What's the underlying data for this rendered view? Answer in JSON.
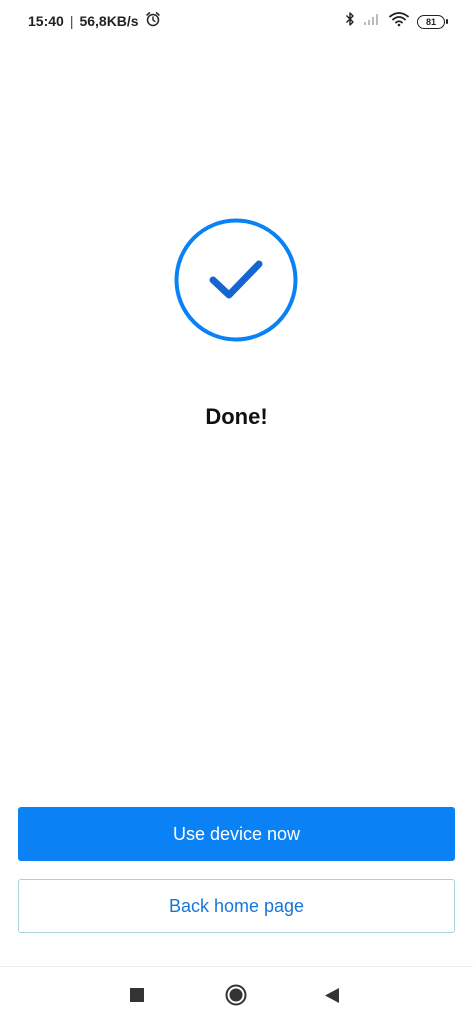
{
  "status_bar": {
    "time": "15:40",
    "separator": "|",
    "network_speed": "56,8KB/s",
    "alarm_icon": "alarm-clock-icon",
    "bluetooth_icon": "bluetooth-icon",
    "signal_icon": "cellular-signal-icon",
    "wifi_icon": "wifi-icon",
    "battery_level": "81"
  },
  "main": {
    "status_icon": "check-circle-icon",
    "title": "Done!",
    "accent_color": "#0a82f6"
  },
  "actions": {
    "primary_label": "Use device now",
    "secondary_label": "Back home page"
  },
  "nav_bar": {
    "recents_icon": "square-recents-icon",
    "home_icon": "circle-home-icon",
    "back_icon": "triangle-back-icon"
  }
}
